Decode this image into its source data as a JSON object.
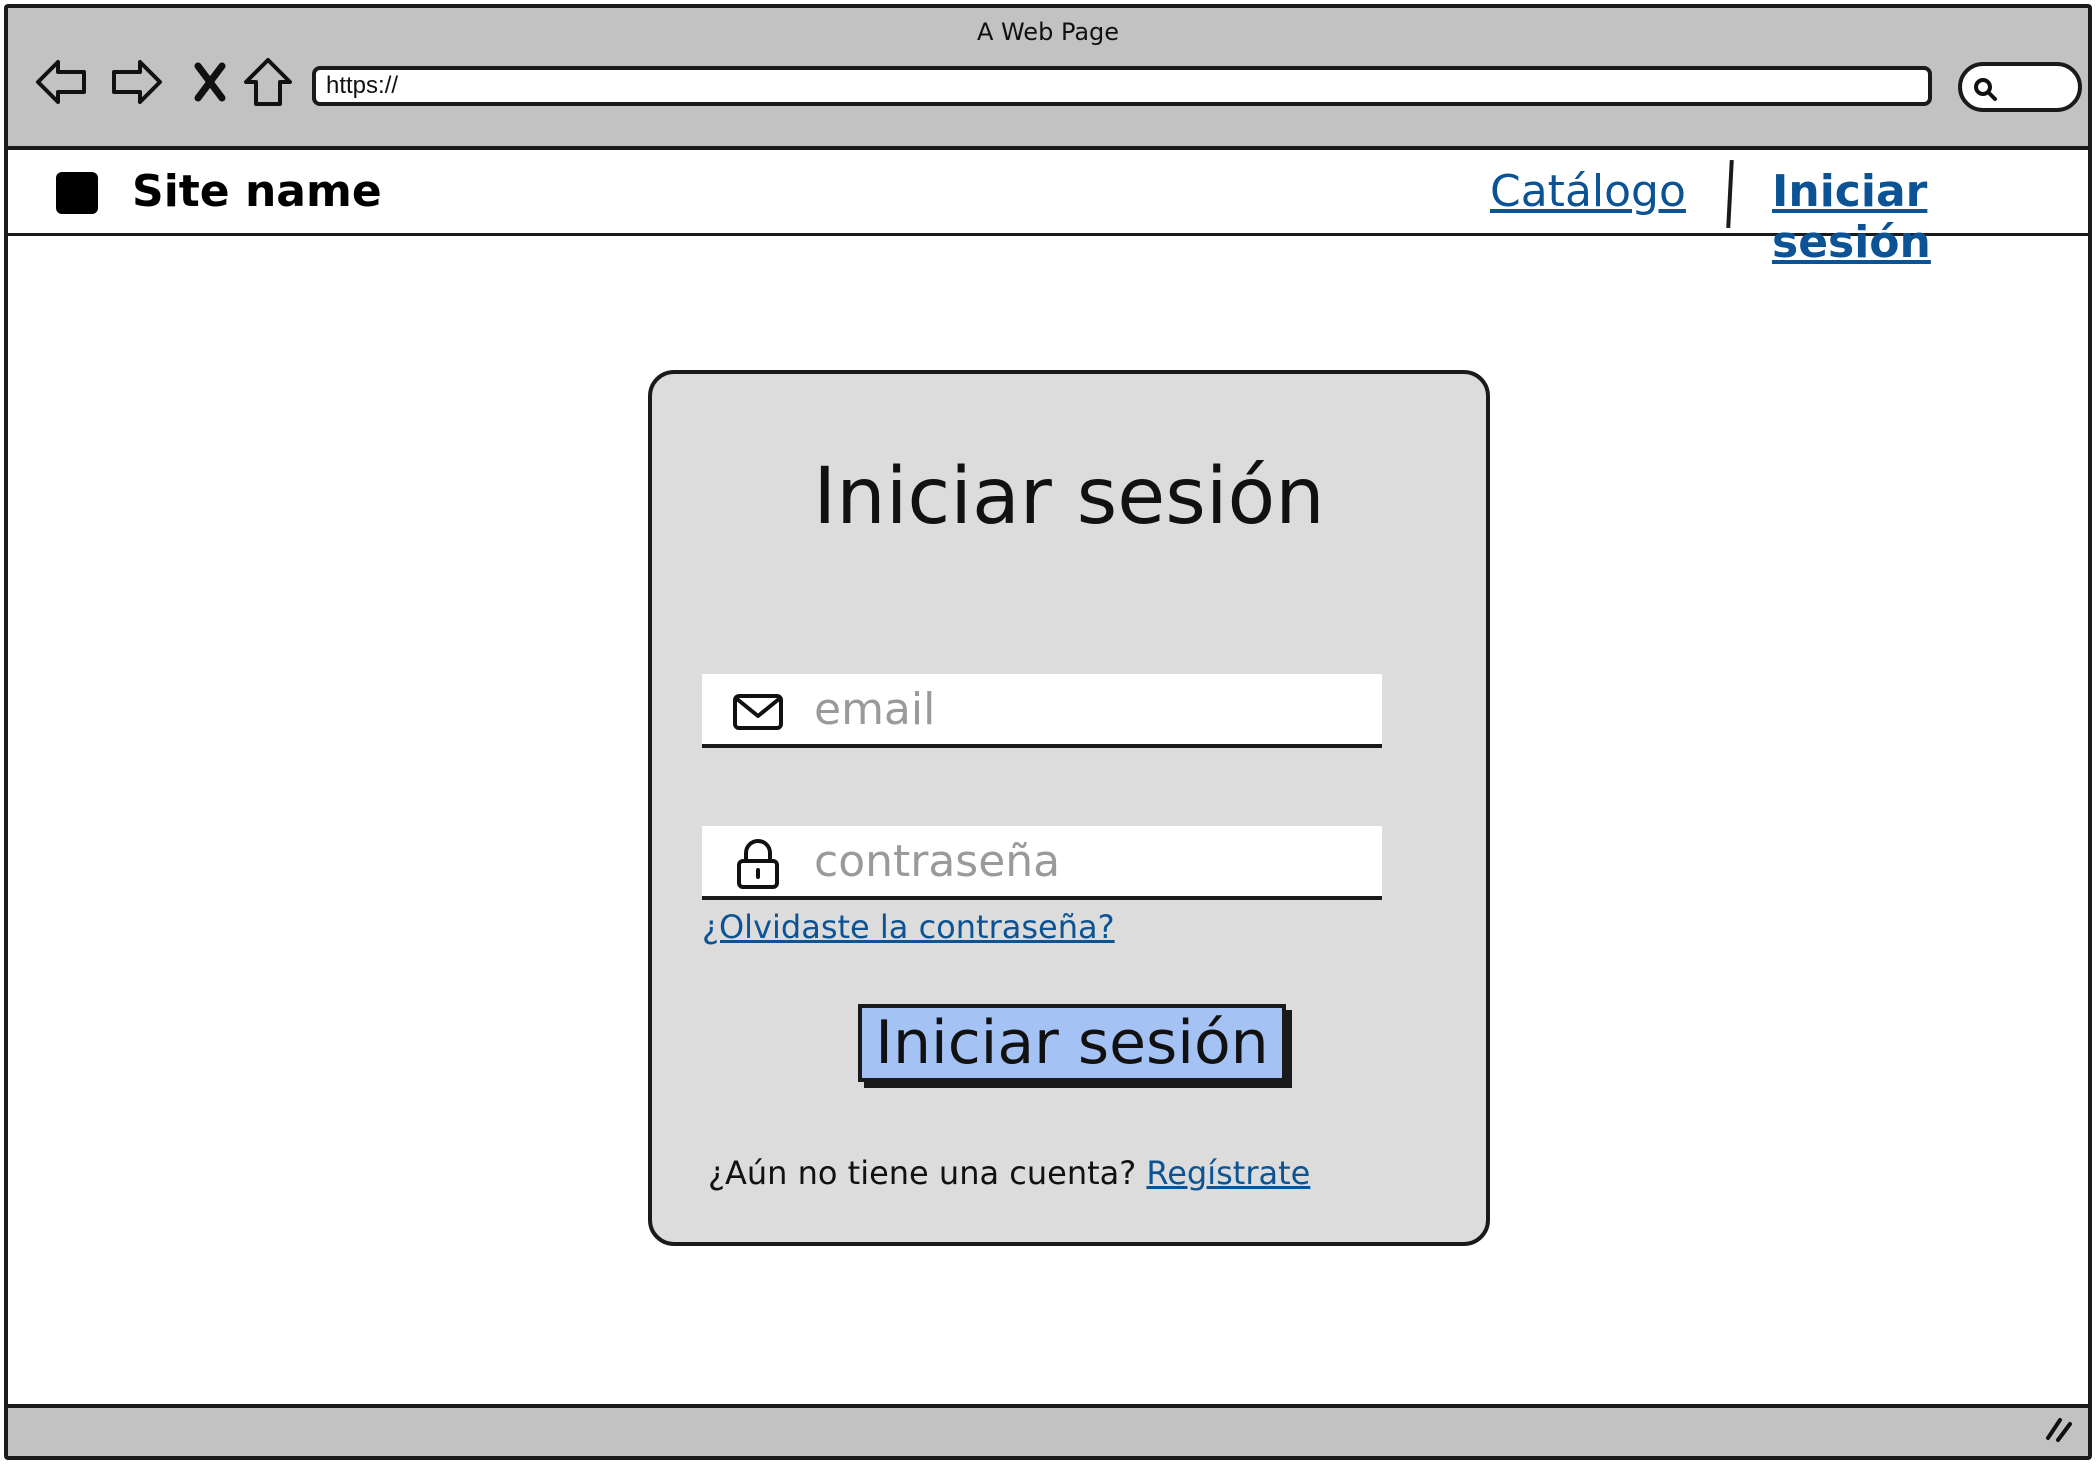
{
  "browser": {
    "window_title": "A Web Page",
    "url": "https://",
    "icons": [
      "back-arrow-icon",
      "forward-arrow-icon",
      "close-icon",
      "home-icon",
      "search-icon",
      "resize-grip-icon"
    ]
  },
  "header": {
    "site_name": "Site name",
    "nav": {
      "catalog": "Catálogo",
      "login": "Iniciar sesión"
    }
  },
  "login_card": {
    "title": "Iniciar sesión",
    "email": {
      "placeholder": "email",
      "value": "",
      "icon": "envelope-icon"
    },
    "password": {
      "placeholder": "contraseña",
      "value": "",
      "icon": "lock-icon"
    },
    "forgot_link": "¿Olvidaste la contraseña?",
    "submit_label": "Iniciar sesión",
    "register_prompt": "¿Aún no tiene una cuenta?",
    "register_link": "Regístrate"
  },
  "colors": {
    "chrome_gray": "#c2c2c2",
    "card_gray": "#dcdcdc",
    "link_blue": "#0b5394",
    "button_blue": "#a4c2f4",
    "outline": "#1a1a1a"
  }
}
